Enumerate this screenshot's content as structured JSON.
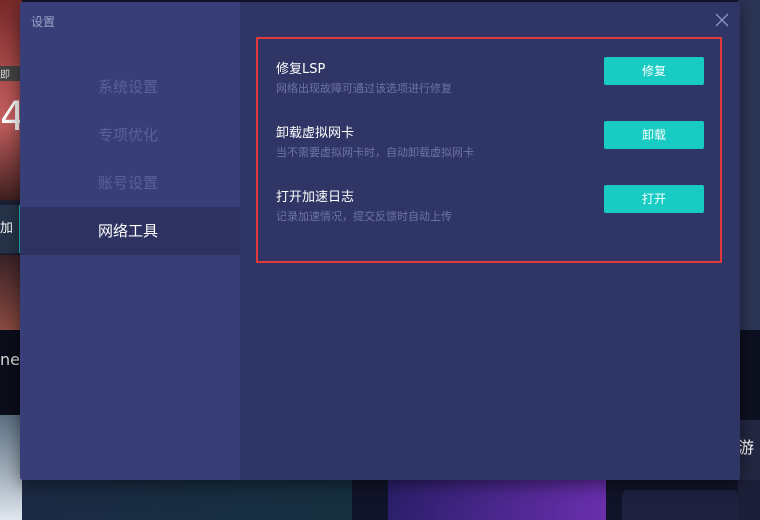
{
  "dialog": {
    "title": "设置",
    "nav": [
      {
        "label": "系统设置",
        "active": false
      },
      {
        "label": "专项优化",
        "active": false
      },
      {
        "label": "账号设置",
        "active": false
      },
      {
        "label": "网络工具",
        "active": true
      }
    ],
    "tools": [
      {
        "title": "修复LSP",
        "description": "网络出现故障可通过该选项进行修复",
        "button": "修复"
      },
      {
        "title": "卸载虚拟网卡",
        "description": "当不需要虚拟网卡时，自动卸载虚拟网卡",
        "button": "卸载"
      },
      {
        "title": "打开加速日志",
        "description": "记录加速情况，提交反馈时自动上传",
        "button": "打开"
      }
    ]
  },
  "background": {
    "left_tag": "即",
    "left_digit": "4",
    "left_tab": "加",
    "left_dark_text": "ne",
    "right_text": "游"
  },
  "colors": {
    "accent": "#18ccc4",
    "highlight_border": "#e03a3a",
    "sidebar_bg": "#383f78",
    "content_bg": "#2f3565"
  }
}
